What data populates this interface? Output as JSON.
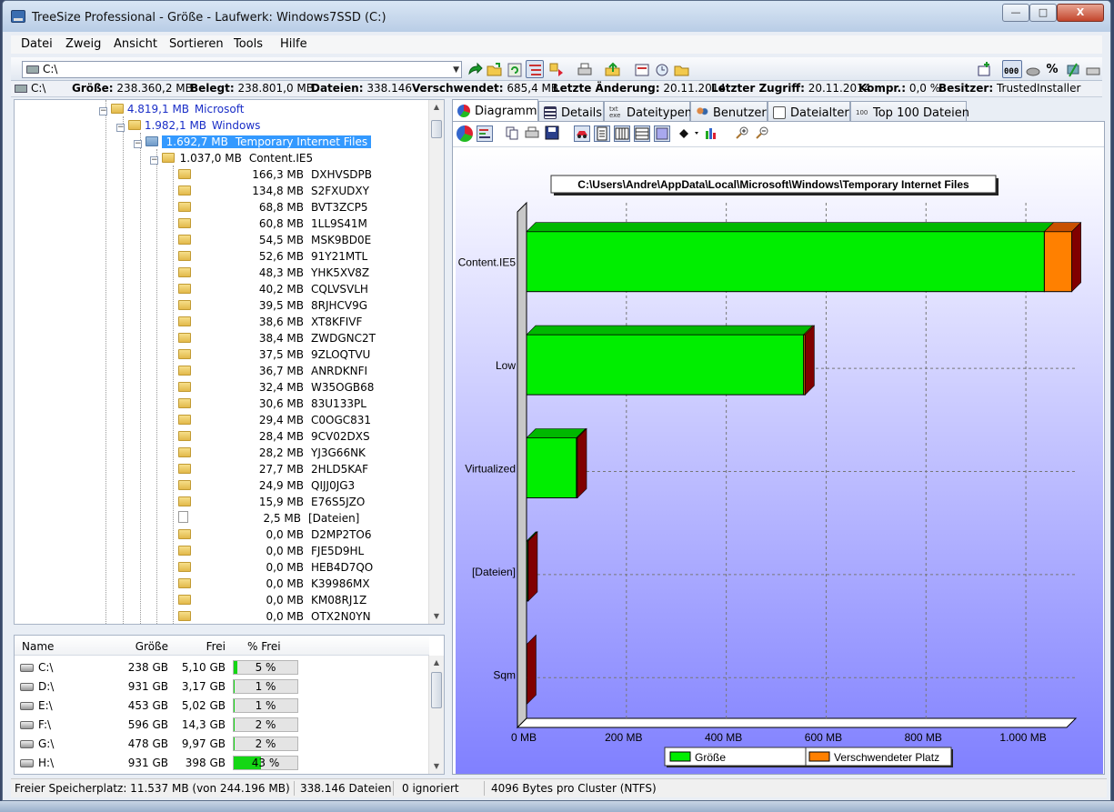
{
  "window": {
    "title": "TreeSize Professional - Größe -  Laufwerk: Windows7SSD (C:)",
    "minimize_label": "—",
    "maximize_label": "□",
    "close_label": "X"
  },
  "menu": [
    "Datei",
    "Zweig",
    "Ansicht",
    "Sortieren",
    "Tools",
    "Hilfe"
  ],
  "toolbar": {
    "path": "C:\\",
    "percent_label": "%"
  },
  "infobar": {
    "drive": "C:\\",
    "size_label": "Größe:",
    "size_value": "238.360,2 MB",
    "used_label": "Belegt:",
    "used_value": "238.801,0 MB",
    "files_label": "Dateien:",
    "files_value": "338.146",
    "wasted_label": "Verschwendet:",
    "wasted_value": "685,4 MB",
    "lastmod_label": "Letzte Änderung:",
    "lastmod_value": "20.11.2014",
    "lastacc_label": "Letzter Zugriff:",
    "lastacc_value": "20.11.2014",
    "compr_label": "Kompr.:",
    "compr_value": "0,0 %",
    "owner_label": "Besitzer:",
    "owner_value": "TrustedInstaller"
  },
  "tree": [
    {
      "size": "4.819,1 MB",
      "name": "Microsoft",
      "level": 0,
      "style": "blue",
      "expander": "−"
    },
    {
      "size": "1.982,1 MB",
      "name": "Windows",
      "level": 1,
      "style": "blue",
      "expander": "−"
    },
    {
      "size": "1.692,7 MB",
      "name": "Temporary Internet Files",
      "level": 2,
      "style": "selected",
      "expander": "−"
    },
    {
      "size": "1.037,0 MB",
      "name": "Content.IE5",
      "level": 3,
      "style": "normal",
      "expander": "−"
    },
    {
      "size": "166,3 MB",
      "name": "DXHVSDPB",
      "level": 4,
      "style": "normal"
    },
    {
      "size": "134,8 MB",
      "name": "S2FXUDXY",
      "level": 4,
      "style": "normal"
    },
    {
      "size": "68,8 MB",
      "name": "BVT3ZCP5",
      "level": 4,
      "style": "normal"
    },
    {
      "size": "60,8 MB",
      "name": "1LL9S41M",
      "level": 4,
      "style": "normal"
    },
    {
      "size": "54,5 MB",
      "name": "MSK9BD0E",
      "level": 4,
      "style": "normal"
    },
    {
      "size": "52,6 MB",
      "name": "91Y21MTL",
      "level": 4,
      "style": "normal"
    },
    {
      "size": "48,3 MB",
      "name": "YHK5XV8Z",
      "level": 4,
      "style": "normal"
    },
    {
      "size": "40,2 MB",
      "name": "CQLVSVLH",
      "level": 4,
      "style": "normal"
    },
    {
      "size": "39,5 MB",
      "name": "8RJHCV9G",
      "level": 4,
      "style": "normal"
    },
    {
      "size": "38,6 MB",
      "name": "XT8KFIVF",
      "level": 4,
      "style": "normal"
    },
    {
      "size": "38,4 MB",
      "name": "ZWDGNC2T",
      "level": 4,
      "style": "normal"
    },
    {
      "size": "37,5 MB",
      "name": "9ZLOQTVU",
      "level": 4,
      "style": "normal"
    },
    {
      "size": "36,7 MB",
      "name": "ANRDKNFI",
      "level": 4,
      "style": "normal"
    },
    {
      "size": "32,4 MB",
      "name": "W35OGB68",
      "level": 4,
      "style": "normal"
    },
    {
      "size": "30,6 MB",
      "name": "83U133PL",
      "level": 4,
      "style": "normal"
    },
    {
      "size": "29,4 MB",
      "name": "C0OGC831",
      "level": 4,
      "style": "normal"
    },
    {
      "size": "28,4 MB",
      "name": "9CV02DXS",
      "level": 4,
      "style": "normal"
    },
    {
      "size": "28,2 MB",
      "name": "YJ3G66NK",
      "level": 4,
      "style": "normal"
    },
    {
      "size": "27,7 MB",
      "name": "2HLD5KAF",
      "level": 4,
      "style": "normal"
    },
    {
      "size": "24,9 MB",
      "name": "QIJJ0JG3",
      "level": 4,
      "style": "normal"
    },
    {
      "size": "15,9 MB",
      "name": "E76S5JZO",
      "level": 4,
      "style": "normal"
    },
    {
      "size": "2,5 MB",
      "name": "[Dateien]",
      "level": 4,
      "style": "normal",
      "file": true
    },
    {
      "size": "0,0 MB",
      "name": "D2MP2TO6",
      "level": 4,
      "style": "normal"
    },
    {
      "size": "0,0 MB",
      "name": "FJE5D9HL",
      "level": 4,
      "style": "normal"
    },
    {
      "size": "0,0 MB",
      "name": "HEB4D7QO",
      "level": 4,
      "style": "normal"
    },
    {
      "size": "0,0 MB",
      "name": "K39986MX",
      "level": 4,
      "style": "normal"
    },
    {
      "size": "0,0 MB",
      "name": "KM08RJ1Z",
      "level": 4,
      "style": "normal"
    },
    {
      "size": "0,0 MB",
      "name": "OTX2N0YN",
      "level": 4,
      "style": "normal"
    }
  ],
  "drives": {
    "headers": {
      "name": "Name",
      "size": "Größe",
      "free": "Frei",
      "pct": "% Frei"
    },
    "rows": [
      {
        "name": "C:\\",
        "size": "238 GB",
        "free": "5,10 GB",
        "pct_label": "5 %",
        "pct": 5
      },
      {
        "name": "D:\\",
        "size": "931 GB",
        "free": "3,17 GB",
        "pct_label": "1 %",
        "pct": 1
      },
      {
        "name": "E:\\",
        "size": "453 GB",
        "free": "5,02 GB",
        "pct_label": "1 %",
        "pct": 1
      },
      {
        "name": "F:\\",
        "size": "596 GB",
        "free": "14,3 GB",
        "pct_label": "2 %",
        "pct": 2
      },
      {
        "name": "G:\\",
        "size": "478 GB",
        "free": "9,97 GB",
        "pct_label": "2 %",
        "pct": 2
      },
      {
        "name": "H:\\",
        "size": "931 GB",
        "free": "398 GB",
        "pct_label": "43 %",
        "pct": 43
      }
    ]
  },
  "status": {
    "free": "Freier Speicherplatz: 11.537 MB  (von 244.196 MB)",
    "files": "338.146 Dateien",
    "ignored": "0 ignoriert",
    "cluster": "4096 Bytes pro Cluster (NTFS)"
  },
  "tabs": [
    "Diagramm",
    "Details",
    "Dateitypen",
    "Benutzer",
    "Dateialter",
    "Top 100 Dateien"
  ],
  "colors": {
    "size": "#00ee00",
    "wasted": "#ff8000",
    "wasted_dark": "#800000",
    "chart_bg_top": "#ffffff",
    "chart_bg_bottom": "#8080ff"
  },
  "chart_data": {
    "type": "bar",
    "orientation": "horizontal",
    "stacked": true,
    "title": "C:\\Users\\Andre\\AppData\\Local\\Microsoft\\Windows\\Temporary Internet Files",
    "categories": [
      "Content.IE5",
      "Low",
      "Virtualized",
      "[Dateien]",
      "Sqm"
    ],
    "series": [
      {
        "name": "Größe",
        "values": [
          1037,
          555,
          100,
          2.5,
          0
        ]
      },
      {
        "name": "Verschwendeter Platz",
        "values": [
          55,
          3,
          2,
          1,
          0.8
        ]
      }
    ],
    "xlim": [
      0,
      1100
    ],
    "xticks": [
      0,
      200,
      400,
      600,
      800,
      1000
    ],
    "xtick_labels": [
      "0 MB",
      "200 MB",
      "400 MB",
      "600 MB",
      "800 MB",
      "1.000 MB"
    ],
    "grid": true,
    "legend": "bottom-center"
  }
}
